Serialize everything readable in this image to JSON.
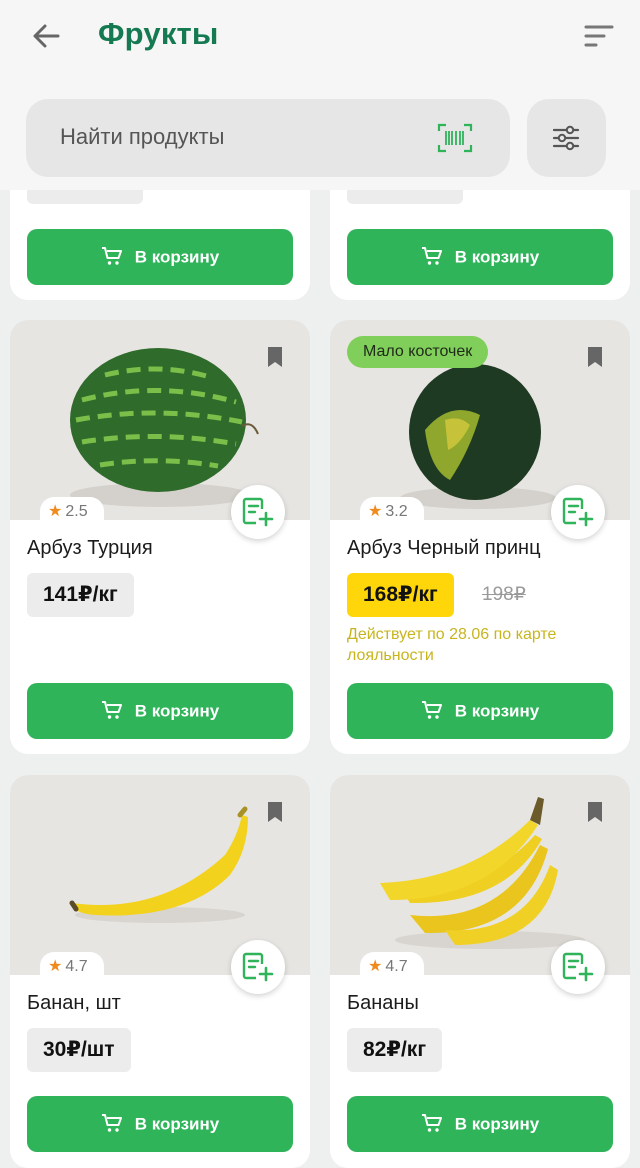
{
  "header": {
    "title": "Фрукты"
  },
  "search": {
    "placeholder": "Найти продукты"
  },
  "cart_label": "В корзину",
  "products": [
    {
      "name": "Арбуз Турция",
      "rating": "2.5",
      "price": "141₽/кг"
    },
    {
      "name": "Арбуз Черный принц",
      "rating": "3.2",
      "price": "168₽/кг",
      "old_price": "198₽",
      "tag": "Мало косточек",
      "promo_note": "Действует по 28.06 по карте лояльности"
    },
    {
      "name": "Банан, шт",
      "rating": "4.7",
      "price": "30₽/шт"
    },
    {
      "name": "Бананы",
      "rating": "4.7",
      "price": "82₽/кг"
    }
  ],
  "colors": {
    "brand_green": "#157a52",
    "button_green": "#2fb45a",
    "promo_yellow": "#ffd60a",
    "rating_star": "#f08a1c"
  },
  "icons": [
    "back-arrow-icon",
    "sort-icon",
    "barcode-icon",
    "filter-icon",
    "bookmark-icon",
    "add-to-list-icon",
    "cart-icon",
    "star-icon"
  ]
}
